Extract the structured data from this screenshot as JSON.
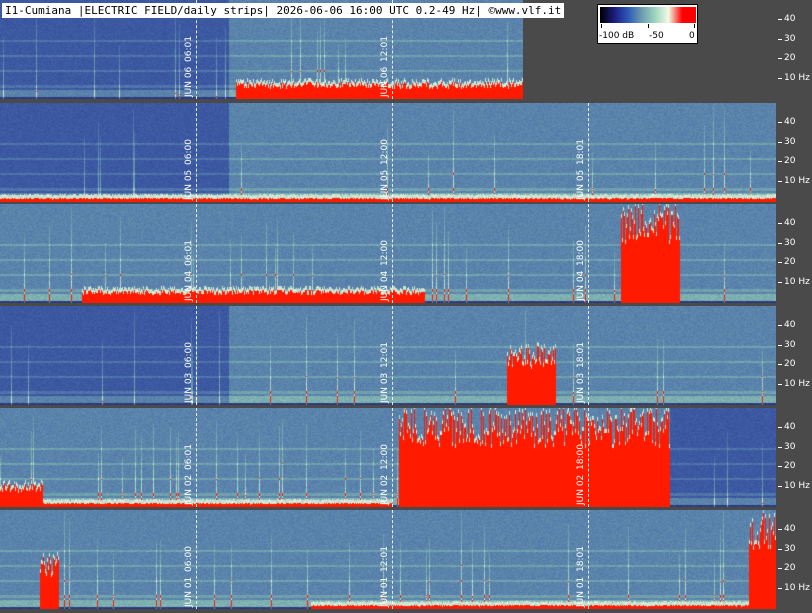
{
  "header": {
    "title": "I1-Cumiana |ELECTRIC FIELD/daily strips| 2026-06-06 16:00 UTC 0.2-49 Hz| ©www.vlf.it"
  },
  "legend": {
    "labels": [
      "-100 dB",
      "-50",
      "0"
    ],
    "colors": [
      "#000000",
      "#1a1a7a",
      "#2d56b8",
      "#6a9ab0",
      "#9dd4c0",
      "#f4fbe4",
      "#ff0000",
      "#ff0000"
    ]
  },
  "colors": {
    "background": "#4a4a4a",
    "deep": "#1c2064",
    "mid": "#3f5ea8",
    "hi": "#80b5b0",
    "line": "#e8f6e2",
    "burst": "#ff1a00"
  },
  "chart_data": {
    "type": "heatmap",
    "title": "I1-Cumiana |ELECTRIC FIELD/daily strips| 2026-06-06 16:00 UTC 0.2-49 Hz| ©www.vlf.it",
    "ylabel": "Hz",
    "y_ticks": [
      {
        "label": "40",
        "value": 40
      },
      {
        "label": "30",
        "value": 30
      },
      {
        "label": "20",
        "value": 20
      },
      {
        "label": "10 Hz",
        "value": 10
      }
    ],
    "ylim": [
      0,
      49
    ],
    "scale_db": [
      -100,
      0
    ],
    "strips": [
      {
        "date": "JUN 06",
        "time_labels": [
          "06:01",
          "12:01"
        ],
        "end_hour": 16.0
      },
      {
        "date": "JUN 05",
        "time_labels": [
          "06:00",
          "12:00",
          "18:01"
        ],
        "end_hour": 24
      },
      {
        "date": "JUN 04",
        "time_labels": [
          "06:01",
          "12:00",
          "18:00"
        ],
        "end_hour": 24
      },
      {
        "date": "JUN 03",
        "time_labels": [
          "06:00",
          "12:01",
          "18:01"
        ],
        "end_hour": 24
      },
      {
        "date": "JUN 02",
        "time_labels": [
          "06:01",
          "12:00",
          "18:00"
        ],
        "end_hour": 24
      },
      {
        "date": "JUN 01",
        "time_labels": [
          "06:00",
          "12:01",
          "18:01"
        ],
        "end_hour": 24
      }
    ]
  }
}
